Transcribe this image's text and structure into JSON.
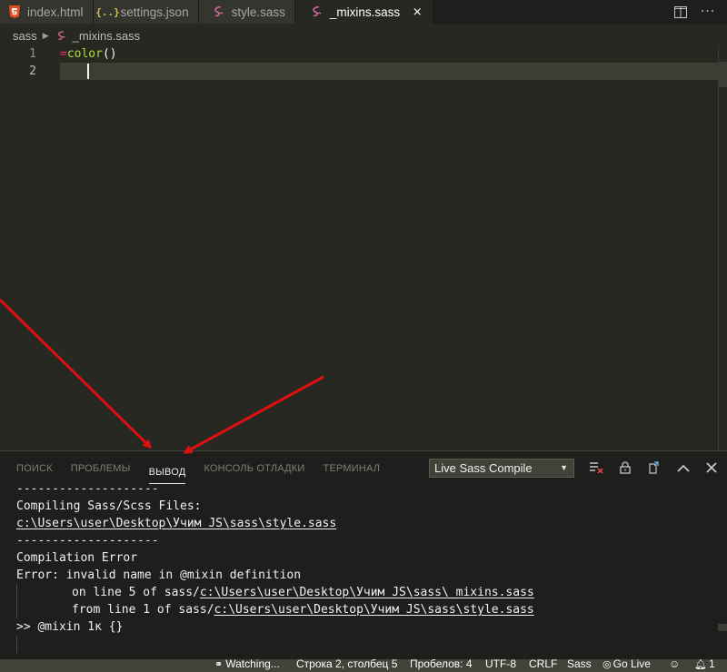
{
  "tabs": [
    {
      "label": "index.html",
      "icon": "html5-icon",
      "active": false
    },
    {
      "label": "settings.json",
      "icon": "json-braces-icon",
      "active": false
    },
    {
      "label": "style.sass",
      "icon": "sass-icon",
      "active": false
    },
    {
      "label": "_mixins.sass",
      "icon": "sass-icon",
      "active": true,
      "close": "×"
    }
  ],
  "breadcrumb": {
    "folder": "sass",
    "file": "_mixins.sass"
  },
  "editor": {
    "lines": [
      {
        "num": "1",
        "op": "=",
        "fn": "color",
        "punct": "()"
      },
      {
        "num": "2"
      }
    ]
  },
  "panel": {
    "tabs": [
      "ПОИСК",
      "ПРОБЛЕМЫ",
      "ВЫВОД",
      "КОНСОЛЬ ОТЛАДКИ",
      "ТЕРМИНАЛ"
    ],
    "active_tab": "ВЫВОД",
    "output_channel": "Live Sass Compile",
    "output": {
      "sep1": "--------------------",
      "compiling": "Compiling Sass/Scss Files:",
      "path1": "c:\\Users\\user\\Desktop\\Учим JS\\sass\\style.sass",
      "sep2": "--------------------",
      "err_title": "Compilation Error",
      "err_msg": "Error: invalid name in @mixin definition",
      "line5_prefix": "on line 5 of sass/",
      "line5_path": "c:\\Users\\user\\Desktop\\Учим JS\\sass\\_mixins.sass",
      "line1_prefix": "from line 1 of sass/",
      "line1_path": "c:\\Users\\user\\Desktop\\Учим JS\\sass\\style.sass",
      "snippet": ">> @mixin 1к {}"
    }
  },
  "statusbar": {
    "watching": "Watching...",
    "position": "Строка 2, столбец 5",
    "spaces": "Пробелов: 4",
    "encoding": "UTF-8",
    "eol": "CRLF",
    "language": "Sass",
    "golive": "Go Live",
    "notifications": "1"
  },
  "colors": {
    "editor_bg": "#272822",
    "panel_bg": "#1e1f1c",
    "statusbar_bg": "#414339",
    "arrow": "#e01010",
    "keyword": "#f92672",
    "function": "#a6e22e"
  }
}
